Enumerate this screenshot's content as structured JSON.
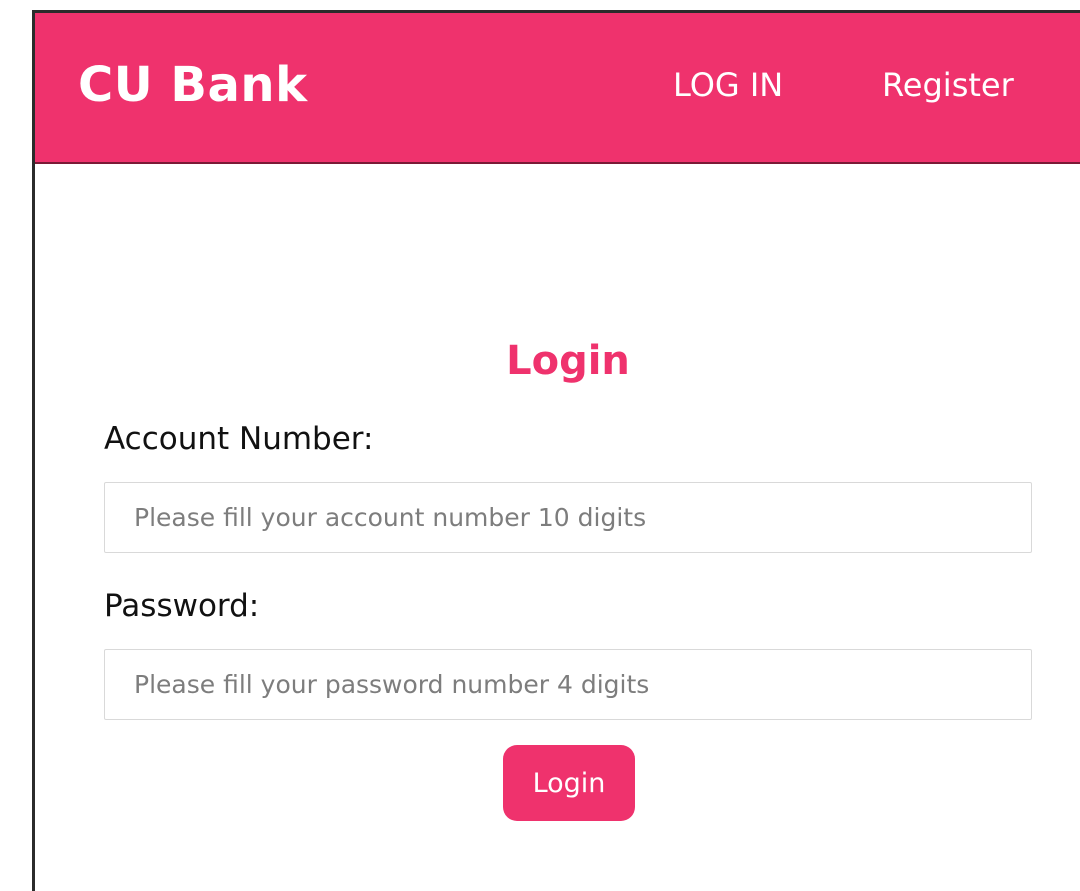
{
  "colors": {
    "brand": "#ef326d",
    "text": "#111111",
    "placeholder": "#7d7d7d",
    "input_border": "#d9d9d9"
  },
  "navbar": {
    "brand": "CU Bank",
    "links": [
      {
        "label": "LOG IN"
      },
      {
        "label": "Register"
      }
    ]
  },
  "login_form": {
    "title": "Login",
    "account": {
      "label": "Account Number:",
      "placeholder": "Please fill your account number 10 digits",
      "value": ""
    },
    "password": {
      "label": "Password:",
      "placeholder": "Please fill your password number 4 digits",
      "value": ""
    },
    "submit_label": "Login"
  }
}
